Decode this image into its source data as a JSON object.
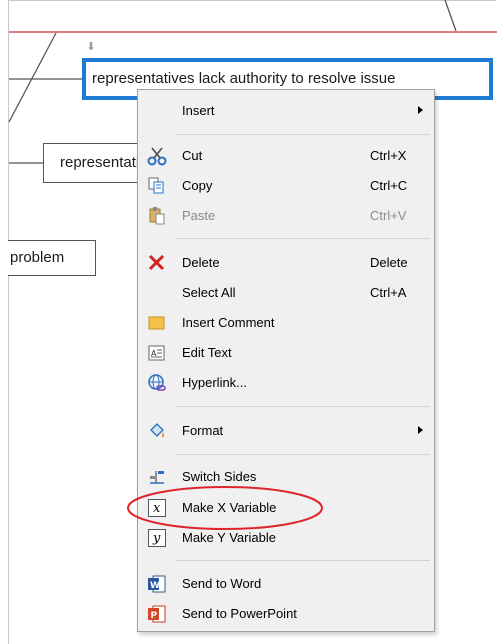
{
  "nodes": {
    "selected": "representatives lack authority to resolve issue",
    "middle": "representatives",
    "left": "problem"
  },
  "menu": {
    "insert": "Insert",
    "cut": "Cut",
    "cut_sc": "Ctrl+X",
    "copy": "Copy",
    "copy_sc": "Ctrl+C",
    "paste": "Paste",
    "paste_sc": "Ctrl+V",
    "delete": "Delete",
    "delete_sc": "Delete",
    "select_all": "Select All",
    "select_all_sc": "Ctrl+A",
    "insert_comment": "Insert Comment",
    "edit_text": "Edit Text",
    "hyperlink": "Hyperlink...",
    "format": "Format",
    "switch_sides": "Switch Sides",
    "make_x": "Make X Variable",
    "make_y": "Make Y Variable",
    "send_word": "Send to Word",
    "send_ppt": "Send to PowerPoint"
  },
  "icons": {
    "x_var": "x",
    "y_var": "y",
    "word": "W",
    "ppt": "P"
  },
  "colors": {
    "selection_border": "#1e7bd1",
    "annotation_red": "#e0242c",
    "guide_line": "#e57a80"
  }
}
